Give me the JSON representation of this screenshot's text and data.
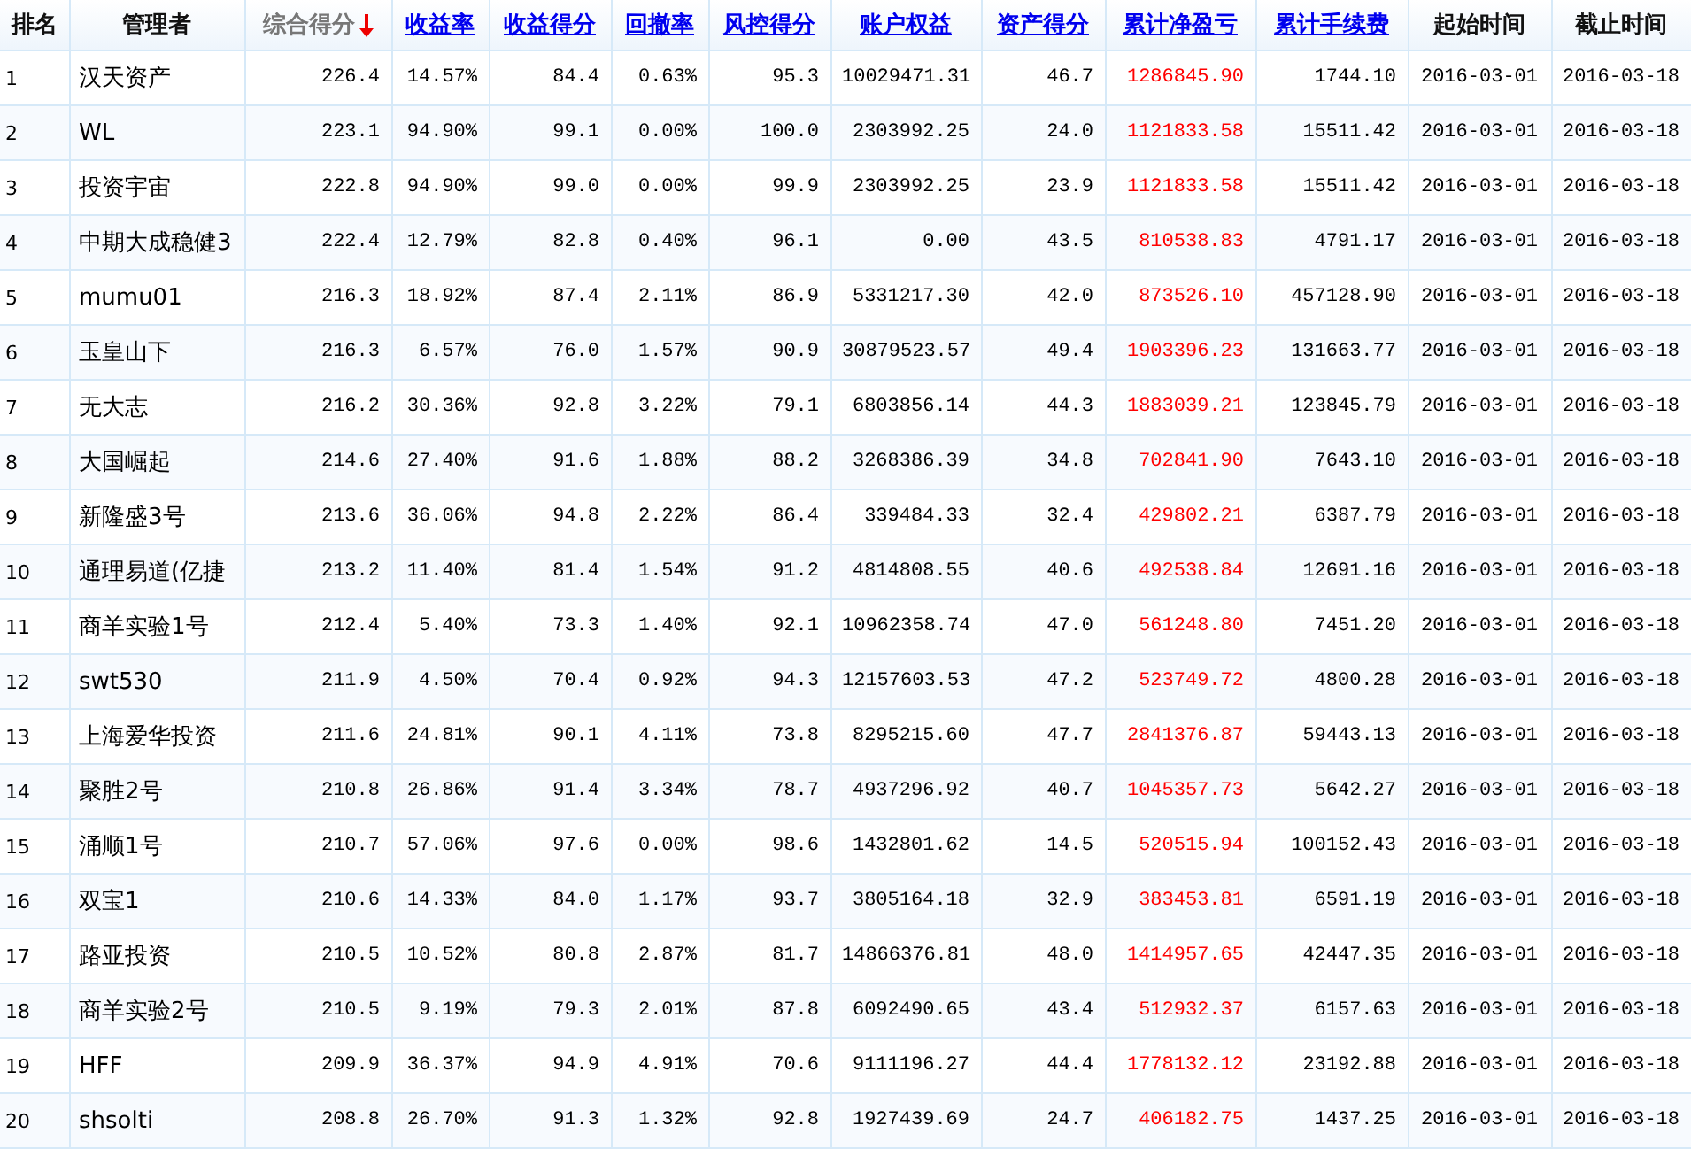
{
  "table": {
    "columns": [
      {
        "label": "排名",
        "kind": "plain",
        "red_values": false
      },
      {
        "label": "管理者",
        "kind": "plain",
        "red_values": false
      },
      {
        "label": "综合得分",
        "kind": "sorted",
        "red_values": false
      },
      {
        "label": "收益率",
        "kind": "link",
        "red_values": false
      },
      {
        "label": "收益得分",
        "kind": "link",
        "red_values": false
      },
      {
        "label": "回撤率",
        "kind": "link",
        "red_values": false
      },
      {
        "label": "风控得分",
        "kind": "link",
        "red_values": false
      },
      {
        "label": "账户权益",
        "kind": "link",
        "red_values": false
      },
      {
        "label": "资产得分",
        "kind": "link",
        "red_values": false
      },
      {
        "label": "累计净盈亏",
        "kind": "link",
        "red_values": true
      },
      {
        "label": "累计手续费",
        "kind": "link",
        "red_values": false
      },
      {
        "label": "起始时间",
        "kind": "plain",
        "red_values": false
      },
      {
        "label": "截止时间",
        "kind": "plain",
        "red_values": false
      }
    ],
    "rows": [
      [
        "1",
        "汉天资产",
        "226.4",
        "14.57%",
        "84.4",
        "0.63%",
        "95.3",
        "10029471.31",
        "46.7",
        "1286845.90",
        "1744.10",
        "2016-03-01",
        "2016-03-18"
      ],
      [
        "2",
        "WL",
        "223.1",
        "94.90%",
        "99.1",
        "0.00%",
        "100.0",
        "2303992.25",
        "24.0",
        "1121833.58",
        "15511.42",
        "2016-03-01",
        "2016-03-18"
      ],
      [
        "3",
        "投资宇宙",
        "222.8",
        "94.90%",
        "99.0",
        "0.00%",
        "99.9",
        "2303992.25",
        "23.9",
        "1121833.58",
        "15511.42",
        "2016-03-01",
        "2016-03-18"
      ],
      [
        "4",
        "中期大成稳健3",
        "222.4",
        "12.79%",
        "82.8",
        "0.40%",
        "96.1",
        "0.00",
        "43.5",
        "810538.83",
        "4791.17",
        "2016-03-01",
        "2016-03-18"
      ],
      [
        "5",
        "mumu01",
        "216.3",
        "18.92%",
        "87.4",
        "2.11%",
        "86.9",
        "5331217.30",
        "42.0",
        "873526.10",
        "457128.90",
        "2016-03-01",
        "2016-03-18"
      ],
      [
        "6",
        "玉皇山下",
        "216.3",
        "6.57%",
        "76.0",
        "1.57%",
        "90.9",
        "30879523.57",
        "49.4",
        "1903396.23",
        "131663.77",
        "2016-03-01",
        "2016-03-18"
      ],
      [
        "7",
        "无大志",
        "216.2",
        "30.36%",
        "92.8",
        "3.22%",
        "79.1",
        "6803856.14",
        "44.3",
        "1883039.21",
        "123845.79",
        "2016-03-01",
        "2016-03-18"
      ],
      [
        "8",
        "大国崛起",
        "214.6",
        "27.40%",
        "91.6",
        "1.88%",
        "88.2",
        "3268386.39",
        "34.8",
        "702841.90",
        "7643.10",
        "2016-03-01",
        "2016-03-18"
      ],
      [
        "9",
        "新隆盛3号",
        "213.6",
        "36.06%",
        "94.8",
        "2.22%",
        "86.4",
        "339484.33",
        "32.4",
        "429802.21",
        "6387.79",
        "2016-03-01",
        "2016-03-18"
      ],
      [
        "10",
        "通理易道(亿捷",
        "213.2",
        "11.40%",
        "81.4",
        "1.54%",
        "91.2",
        "4814808.55",
        "40.6",
        "492538.84",
        "12691.16",
        "2016-03-01",
        "2016-03-18"
      ],
      [
        "11",
        "商羊实验1号",
        "212.4",
        "5.40%",
        "73.3",
        "1.40%",
        "92.1",
        "10962358.74",
        "47.0",
        "561248.80",
        "7451.20",
        "2016-03-01",
        "2016-03-18"
      ],
      [
        "12",
        "swt530",
        "211.9",
        "4.50%",
        "70.4",
        "0.92%",
        "94.3",
        "12157603.53",
        "47.2",
        "523749.72",
        "4800.28",
        "2016-03-01",
        "2016-03-18"
      ],
      [
        "13",
        "上海爱华投资",
        "211.6",
        "24.81%",
        "90.1",
        "4.11%",
        "73.8",
        "8295215.60",
        "47.7",
        "2841376.87",
        "59443.13",
        "2016-03-01",
        "2016-03-18"
      ],
      [
        "14",
        "聚胜2号",
        "210.8",
        "26.86%",
        "91.4",
        "3.34%",
        "78.7",
        "4937296.92",
        "40.7",
        "1045357.73",
        "5642.27",
        "2016-03-01",
        "2016-03-18"
      ],
      [
        "15",
        "涌顺1号",
        "210.7",
        "57.06%",
        "97.6",
        "0.00%",
        "98.6",
        "1432801.62",
        "14.5",
        "520515.94",
        "100152.43",
        "2016-03-01",
        "2016-03-18"
      ],
      [
        "16",
        "双宝1",
        "210.6",
        "14.33%",
        "84.0",
        "1.17%",
        "93.7",
        "3805164.18",
        "32.9",
        "383453.81",
        "6591.19",
        "2016-03-01",
        "2016-03-18"
      ],
      [
        "17",
        "路亚投资",
        "210.5",
        "10.52%",
        "80.8",
        "2.87%",
        "81.7",
        "14866376.81",
        "48.0",
        "1414957.65",
        "42447.35",
        "2016-03-01",
        "2016-03-18"
      ],
      [
        "18",
        "商羊实验2号",
        "210.5",
        "9.19%",
        "79.3",
        "2.01%",
        "87.8",
        "6092490.65",
        "43.4",
        "512932.37",
        "6157.63",
        "2016-03-01",
        "2016-03-18"
      ],
      [
        "19",
        "HFF",
        "209.9",
        "36.37%",
        "94.9",
        "4.91%",
        "70.6",
        "9111196.27",
        "44.4",
        "1778132.12",
        "23192.88",
        "2016-03-01",
        "2016-03-18"
      ],
      [
        "20",
        "shsolti",
        "208.8",
        "26.70%",
        "91.3",
        "1.32%",
        "92.8",
        "1927439.69",
        "24.7",
        "406182.75",
        "1437.25",
        "2016-03-01",
        "2016-03-18"
      ]
    ]
  }
}
